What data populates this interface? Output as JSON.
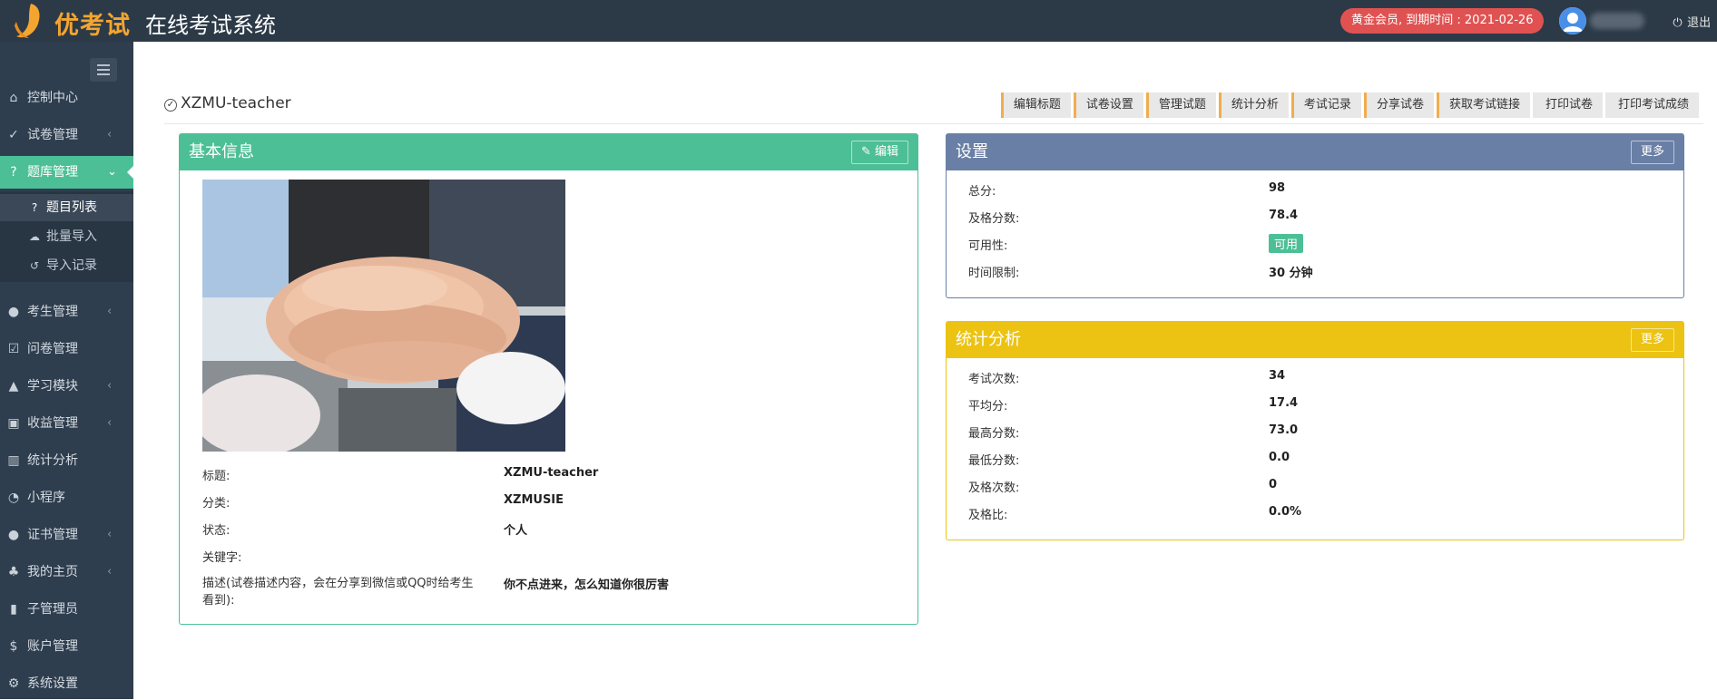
{
  "brand": {
    "logo_text": "优考试",
    "system_title": "在线考试系统"
  },
  "header": {
    "vip_text": "黄金会员, 到期时间 : 2021-02-26",
    "logout_label": "退出"
  },
  "sidebar": {
    "items": [
      {
        "label": "控制中心",
        "icon": "home-icon",
        "has_arrow": false
      },
      {
        "label": "试卷管理",
        "icon": "check-circle-icon",
        "has_arrow": true
      },
      {
        "label": "题库管理",
        "icon": "question-circle-icon",
        "has_arrow": true,
        "active": true
      },
      {
        "label": "考生管理",
        "icon": "user-icon",
        "has_arrow": true
      },
      {
        "label": "问卷管理",
        "icon": "checkbox-icon",
        "has_arrow": false
      },
      {
        "label": "学习模块",
        "icon": "graduation-cap-icon",
        "has_arrow": true
      },
      {
        "label": "收益管理",
        "icon": "money-icon",
        "has_arrow": true
      },
      {
        "label": "统计分析",
        "icon": "bar-chart-icon",
        "has_arrow": false
      },
      {
        "label": "小程序",
        "icon": "wechat-icon",
        "has_arrow": false
      },
      {
        "label": "证书管理",
        "icon": "certificate-icon",
        "has_arrow": true
      },
      {
        "label": "我的主页",
        "icon": "leaf-icon",
        "has_arrow": true
      },
      {
        "label": "子管理员",
        "icon": "lock-icon",
        "has_arrow": false
      },
      {
        "label": "账户管理",
        "icon": "dollar-icon",
        "has_arrow": false
      },
      {
        "label": "系统设置",
        "icon": "gear-icon",
        "has_arrow": false
      }
    ],
    "submenu": [
      {
        "label": "题目列表",
        "icon": "question-circle-icon",
        "current": true
      },
      {
        "label": "批量导入",
        "icon": "cloud-upload-icon"
      },
      {
        "label": "导入记录",
        "icon": "history-icon"
      }
    ]
  },
  "main": {
    "title": "XZMU-teacher",
    "toolbar": [
      "编辑标题",
      "试卷设置",
      "管理试题",
      "统计分析",
      "考试记录",
      "分享试卷",
      "获取考试链接",
      "打印试卷",
      "打印考试成绩"
    ]
  },
  "basic_info": {
    "heading": "基本信息",
    "edit_label": "编辑",
    "rows": [
      {
        "label": "标题:",
        "value": "XZMU-teacher"
      },
      {
        "label": "分类:",
        "value": "XZMUSIE"
      },
      {
        "label": "状态:",
        "value": "个人"
      },
      {
        "label": "关键字:",
        "value": ""
      },
      {
        "label": "描述(试卷描述内容，会在分享到微信或QQ时给考生看到):",
        "value": "你不点进来，怎么知道你很厉害"
      }
    ]
  },
  "settings": {
    "heading": "设置",
    "more_label": "更多",
    "rows": [
      {
        "label": "总分:",
        "value": "98"
      },
      {
        "label": "及格分数:",
        "value": "78.4"
      },
      {
        "label": "可用性:",
        "value": "可用",
        "tag": true
      },
      {
        "label": "时间限制:",
        "value": "30 分钟"
      }
    ]
  },
  "stats": {
    "heading": "统计分析",
    "more_label": "更多",
    "rows": [
      {
        "label": "考试次数:",
        "value": "34"
      },
      {
        "label": "平均分:",
        "value": "17.4"
      },
      {
        "label": "最高分数:",
        "value": "73.0"
      },
      {
        "label": "最低分数:",
        "value": "0.0"
      },
      {
        "label": "及格次数:",
        "value": "0"
      },
      {
        "label": "及格比:",
        "value": "0.0%"
      }
    ]
  },
  "colors": {
    "topbar": "#2c3a48",
    "sidebar": "#2f3e4e",
    "active": "#4dbf97",
    "settings_head": "#6a7fa5",
    "stats_head": "#ecc312",
    "vip": "#e05252",
    "toolbar_accent": "#f0ad4e"
  }
}
